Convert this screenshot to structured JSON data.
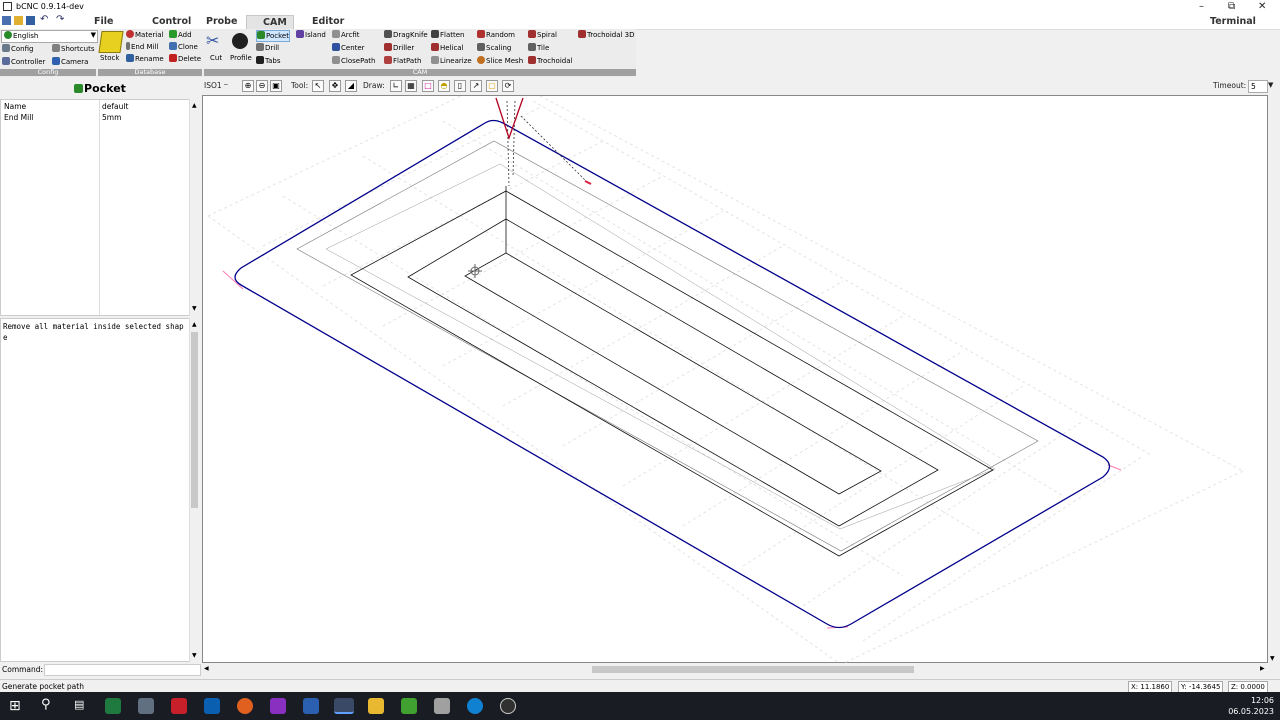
{
  "window": {
    "title": "bCNC 0.9.14-dev"
  },
  "menu": {
    "items": [
      "File",
      "Control",
      "Probe",
      "CAM",
      "Editor"
    ],
    "terminal": "Terminal"
  },
  "ribbon": {
    "config": {
      "language": "English",
      "config": "Config",
      "shortcuts": "Shortcuts",
      "controller": "Controller",
      "camera": "Camera",
      "group": "Config"
    },
    "database": {
      "stock": "Stock",
      "material": "Material",
      "end_mill": "End Mill",
      "rename": "Rename",
      "add": "Add",
      "clone": "Clone",
      "delete": "Delete",
      "group": "Database"
    },
    "cam": {
      "cut": "Cut",
      "profile": "Profile",
      "pocket": "Pocket",
      "drill": "Drill",
      "tabs": "Tabs",
      "island": "Island",
      "arcfit": "Arcfit",
      "center": "Center",
      "closepath": "ClosePath",
      "dragknife": "DragKnife",
      "driller": "Driller",
      "flatpath": "FlatPath",
      "flatten": "Flatten",
      "helical": "Helical",
      "linearize": "Linearize",
      "random": "Random",
      "scaling": "Scaling",
      "slice_mesh": "Slice Mesh",
      "spiral": "Spiral",
      "tile": "Tile",
      "trochoidal": "Trochoidal",
      "trochoidal3d": "Trochoidal 3D",
      "group": "CAM"
    }
  },
  "toolbar": {
    "view": "ISO1",
    "tool_label": "Tool:",
    "draw_label": "Draw:",
    "timeout_label": "Timeout:",
    "timeout_value": "5"
  },
  "panel": {
    "title": "Pocket",
    "properties": [
      {
        "name": "Name",
        "value": "default"
      },
      {
        "name": "End Mill",
        "value": "5mm"
      }
    ],
    "description": "Remove all material inside selected shape"
  },
  "command": {
    "label": "Command:"
  },
  "status": {
    "message": "Generate pocket path",
    "x": "X: 11.1860",
    "y": "Y: -14.3645",
    "z": "Z: 0.0000"
  },
  "clock": {
    "time": "12:06",
    "date": "06.05.2023"
  },
  "colors": {
    "path": "#00008b",
    "marker": "#ff3060",
    "accent": "#0078d7"
  }
}
